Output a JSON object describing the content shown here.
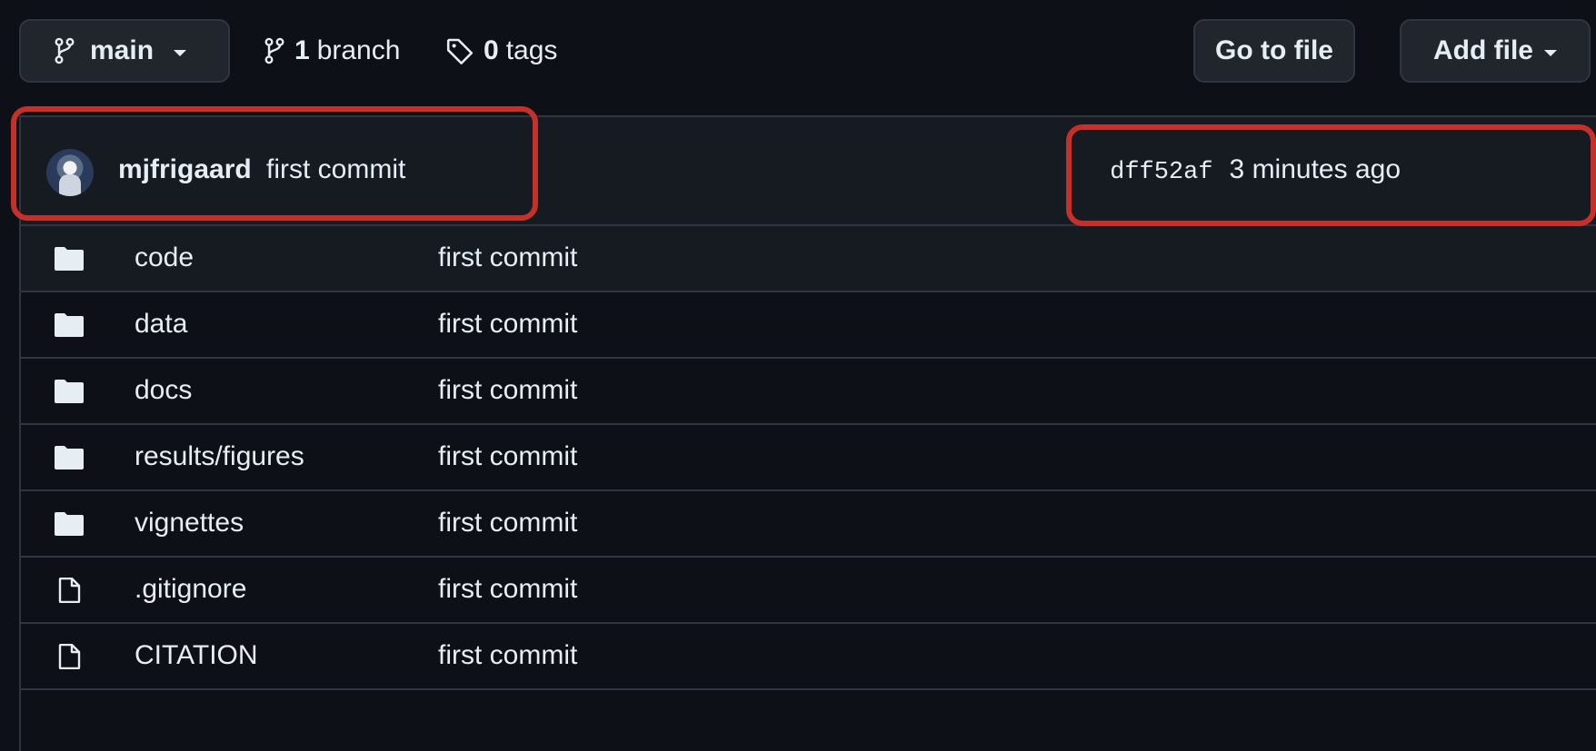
{
  "toolbar": {
    "branch_label": "main",
    "branches_count": "1",
    "branches_text": "branch",
    "tags_count": "0",
    "tags_text": "tags",
    "goto_file_label": "Go to file",
    "add_file_label": "Add file"
  },
  "latest_commit": {
    "author": "mjfrigaard",
    "message": "first commit",
    "hash": "dff52af",
    "time": "3 minutes ago"
  },
  "files": [
    {
      "name": "code",
      "type": "folder",
      "message": "first commit"
    },
    {
      "name": "data",
      "type": "folder",
      "message": "first commit"
    },
    {
      "name": "docs",
      "type": "folder",
      "message": "first commit"
    },
    {
      "name": "results/figures",
      "type": "folder",
      "message": "first commit"
    },
    {
      "name": "vignettes",
      "type": "folder",
      "message": "first commit"
    },
    {
      "name": ".gitignore",
      "type": "file",
      "message": "first commit"
    },
    {
      "name": "CITATION",
      "type": "file",
      "message": "first commit"
    }
  ],
  "icons": {
    "branch": "git-branch-icon",
    "tag": "tag-icon",
    "folder": "folder-icon",
    "file": "file-icon"
  },
  "colors": {
    "background": "#0d1117",
    "header": "#161b22",
    "border": "#30363d",
    "annotation": "#c5302b"
  }
}
